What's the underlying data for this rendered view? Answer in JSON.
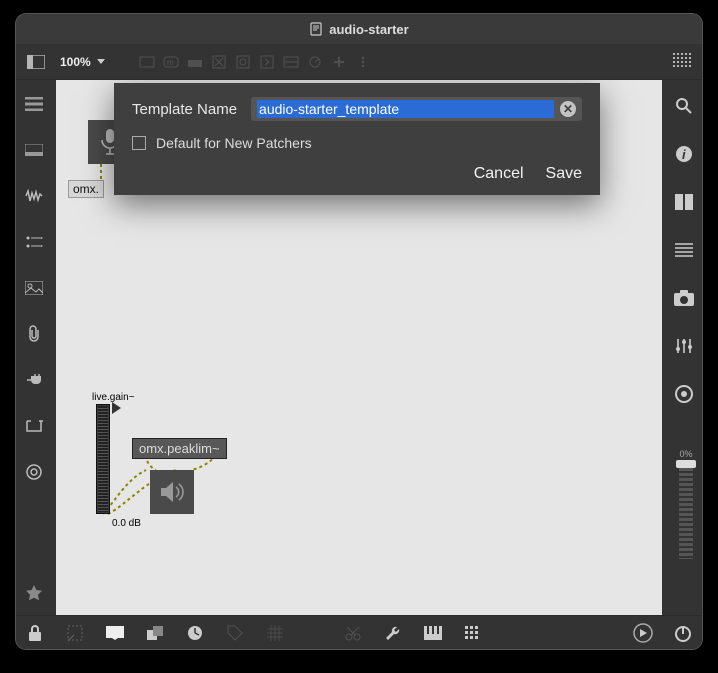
{
  "title": "audio-starter",
  "zoom": "100%",
  "dialog": {
    "label": "Template Name",
    "value": "audio-starter_template",
    "default_label": "Default for New Patchers",
    "cancel": "Cancel",
    "save": "Save"
  },
  "canvas": {
    "omx_label": "omx.",
    "gain_label": "live.gain~",
    "gain_db": "0.0 dB",
    "peaklim_label": "omx.peaklim~"
  },
  "right": {
    "slider_pct": "0%"
  },
  "left_tools": [
    "list",
    "panel",
    "waveform",
    "matrix",
    "image",
    "clip",
    "plug",
    "bracket",
    "target",
    "star"
  ],
  "right_tools": [
    "search",
    "info",
    "columns",
    "listview",
    "camera",
    "sliders",
    "record"
  ],
  "top_tools": [
    "sidebar-toggle",
    "rect",
    "m",
    "comment",
    "boxx",
    "stop",
    "play",
    "minus",
    "clock",
    "plus",
    "dots",
    "grid"
  ],
  "bottom_tools": [
    "lock",
    "select",
    "present",
    "layers",
    "clock",
    "tag",
    "grid",
    "gap",
    "wrench",
    "piano",
    "grid2",
    "gap2",
    "play-circle",
    "power"
  ]
}
